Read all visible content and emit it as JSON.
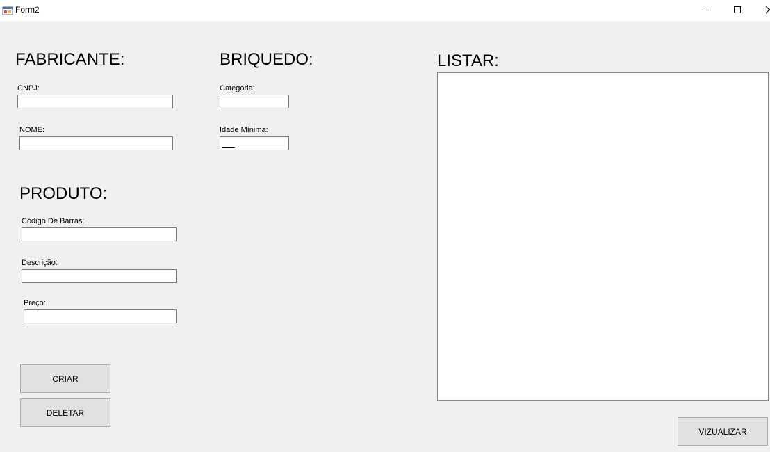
{
  "window": {
    "title": "Form2",
    "icons": {
      "app": "form-app-icon",
      "minimize": "minimize-icon",
      "maximize": "maximize-icon",
      "close": "close-icon"
    }
  },
  "fabricante": {
    "heading": "FABRICANTE:",
    "cnpj_label": "CNPJ:",
    "cnpj_value": "",
    "nome_label": "NOME:",
    "nome_value": ""
  },
  "brinquedo": {
    "heading": "BRIQUEDO:",
    "categoria_label": "Categoria:",
    "categoria_value": "",
    "idade_label": "Idade Mínima:",
    "idade_value": ""
  },
  "produto": {
    "heading": "PRODUTO:",
    "codigo_label": "Código De Barras:",
    "codigo_value": "",
    "descricao_label": "Descrição:",
    "descricao_value": "",
    "preco_label": "Preço:",
    "preco_value": ""
  },
  "actions": {
    "criar_label": "CRIAR",
    "deletar_label": "DELETAR"
  },
  "listar": {
    "heading": "LISTAR:",
    "items": [],
    "vizualizar_label": "VIZUALIZAR"
  }
}
